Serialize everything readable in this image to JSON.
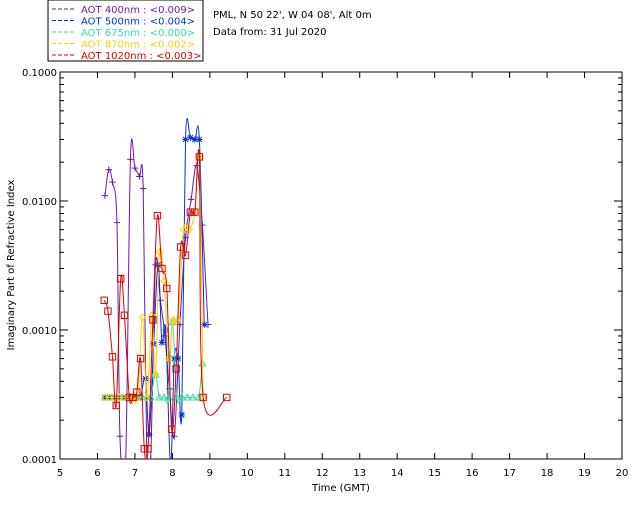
{
  "header": {
    "site": "PML, N 50 22', W 04 08', Alt 0m",
    "date": "Data from: 31 Jul 2020"
  },
  "chart_data": {
    "type": "line",
    "xlabel": "Time (GMT)",
    "ylabel": "Imaginary Part of Refractive Index",
    "xlim": [
      5,
      20
    ],
    "ylim": [
      0.0001,
      0.1
    ],
    "yscale": "log",
    "xticks": [
      "5",
      "6",
      "7",
      "8",
      "9",
      "10",
      "11",
      "12",
      "13",
      "14",
      "15",
      "16",
      "17",
      "18",
      "19",
      "20"
    ],
    "yticks": [
      {
        "value": 0.0001,
        "label": "0.0001"
      },
      {
        "value": 0.001,
        "label": "0.0010"
      },
      {
        "value": 0.01,
        "label": "0.0100"
      },
      {
        "value": 0.1,
        "label": "0.1000"
      }
    ],
    "legend_position": "top-left",
    "series": [
      {
        "name": "AOT  400nm : <0.009>",
        "color": "#6a1aa8",
        "marker": "plus",
        "x": [
          6.2,
          6.3,
          6.4,
          6.52,
          6.6,
          6.75,
          6.88,
          7.0,
          7.12,
          7.22,
          7.32,
          7.42,
          7.55,
          7.68,
          7.8,
          7.92,
          8.05,
          8.2,
          8.35,
          8.5,
          8.65,
          8.8,
          8.95
        ],
        "y": [
          0.011,
          0.0175,
          0.014,
          0.0068,
          0.00015,
          7.5e-05,
          0.021,
          0.018,
          0.0155,
          0.0125,
          8e-05,
          0.0001,
          0.0032,
          0.0017,
          0.0009,
          0.00035,
          0.00015,
          0.0011,
          0.0052,
          0.0103,
          0.0188,
          0.0065,
          0.0011
        ]
      },
      {
        "name": "AOT  500nm : <0.004>",
        "color": "#0b2fd8",
        "marker": "asterisk",
        "x": [
          6.2,
          6.32,
          6.45,
          6.58,
          6.7,
          6.82,
          6.95,
          7.05,
          7.15,
          7.28,
          7.38,
          7.5,
          7.62,
          7.72,
          7.82,
          7.95,
          8.05,
          8.15,
          8.25,
          8.35,
          8.48,
          8.6,
          8.72,
          8.85
        ],
        "y": [
          0.0003,
          0.0003,
          0.0003,
          0.0003,
          0.0003,
          0.0003,
          0.0003,
          0.0003,
          0.0003,
          0.00042,
          0.000155,
          0.00078,
          0.0032,
          0.0008,
          0.001,
          7e-05,
          0.0006,
          0.0006,
          0.00022,
          0.03,
          0.031,
          0.03,
          0.03,
          0.0011
        ]
      },
      {
        "name": "AOT  675nm : <0.000>",
        "color": "#2fe0a0",
        "marker": "triangle",
        "x": [
          6.2,
          6.32,
          6.45,
          6.58,
          6.7,
          6.82,
          6.95,
          7.05,
          7.2,
          7.32,
          7.42,
          7.55,
          7.65,
          7.78,
          7.9,
          8.0,
          8.12,
          8.25,
          8.4,
          8.55,
          8.7,
          8.8
        ],
        "y": [
          0.0003,
          0.0003,
          0.0003,
          0.0003,
          0.0003,
          0.0003,
          0.0003,
          0.0003,
          0.0003,
          0.0003,
          0.0003,
          0.00045,
          0.0003,
          0.0003,
          0.0003,
          0.00115,
          0.0003,
          0.0003,
          0.0003,
          0.0003,
          0.0003,
          0.00055
        ]
      },
      {
        "name": "AOT  870nm : <0.002>",
        "color": "#ffd000",
        "marker": "diamond",
        "x": [
          6.2,
          6.32,
          6.45,
          6.58,
          6.7,
          6.82,
          6.95,
          7.08,
          7.2,
          7.32,
          7.45,
          7.55,
          7.65,
          7.78,
          7.9,
          8.02,
          8.15,
          8.3,
          8.45,
          8.6,
          8.72,
          8.82
        ],
        "y": [
          0.0003,
          0.0003,
          0.0003,
          0.0003,
          0.0003,
          0.0003,
          0.0003,
          0.0003,
          0.00125,
          0.0003,
          0.0013,
          0.00045,
          0.004,
          0.0024,
          0.0006,
          0.0012,
          0.0012,
          0.006,
          0.006,
          0.0082,
          0.022,
          0.0003
        ]
      },
      {
        "name": "AOT 1020nm : <0.003>",
        "color": "#e00000",
        "marker": "square",
        "x": [
          6.18,
          6.28,
          6.4,
          6.5,
          6.62,
          6.72,
          6.85,
          6.95,
          7.05,
          7.15,
          7.25,
          7.35,
          7.48,
          7.6,
          7.72,
          7.85,
          7.98,
          8.1,
          8.22,
          8.35,
          8.48,
          8.6,
          8.72,
          8.82,
          9.45
        ],
        "y": [
          0.0017,
          0.0014,
          0.00062,
          0.00026,
          0.0025,
          0.0013,
          0.0003,
          0.0003,
          0.00033,
          0.0006,
          0.00012,
          0.00012,
          0.0012,
          0.0077,
          0.003,
          0.0021,
          0.00017,
          0.0005,
          0.0044,
          0.0038,
          0.0082,
          0.0082,
          0.022,
          0.0003,
          0.0003
        ]
      }
    ]
  }
}
